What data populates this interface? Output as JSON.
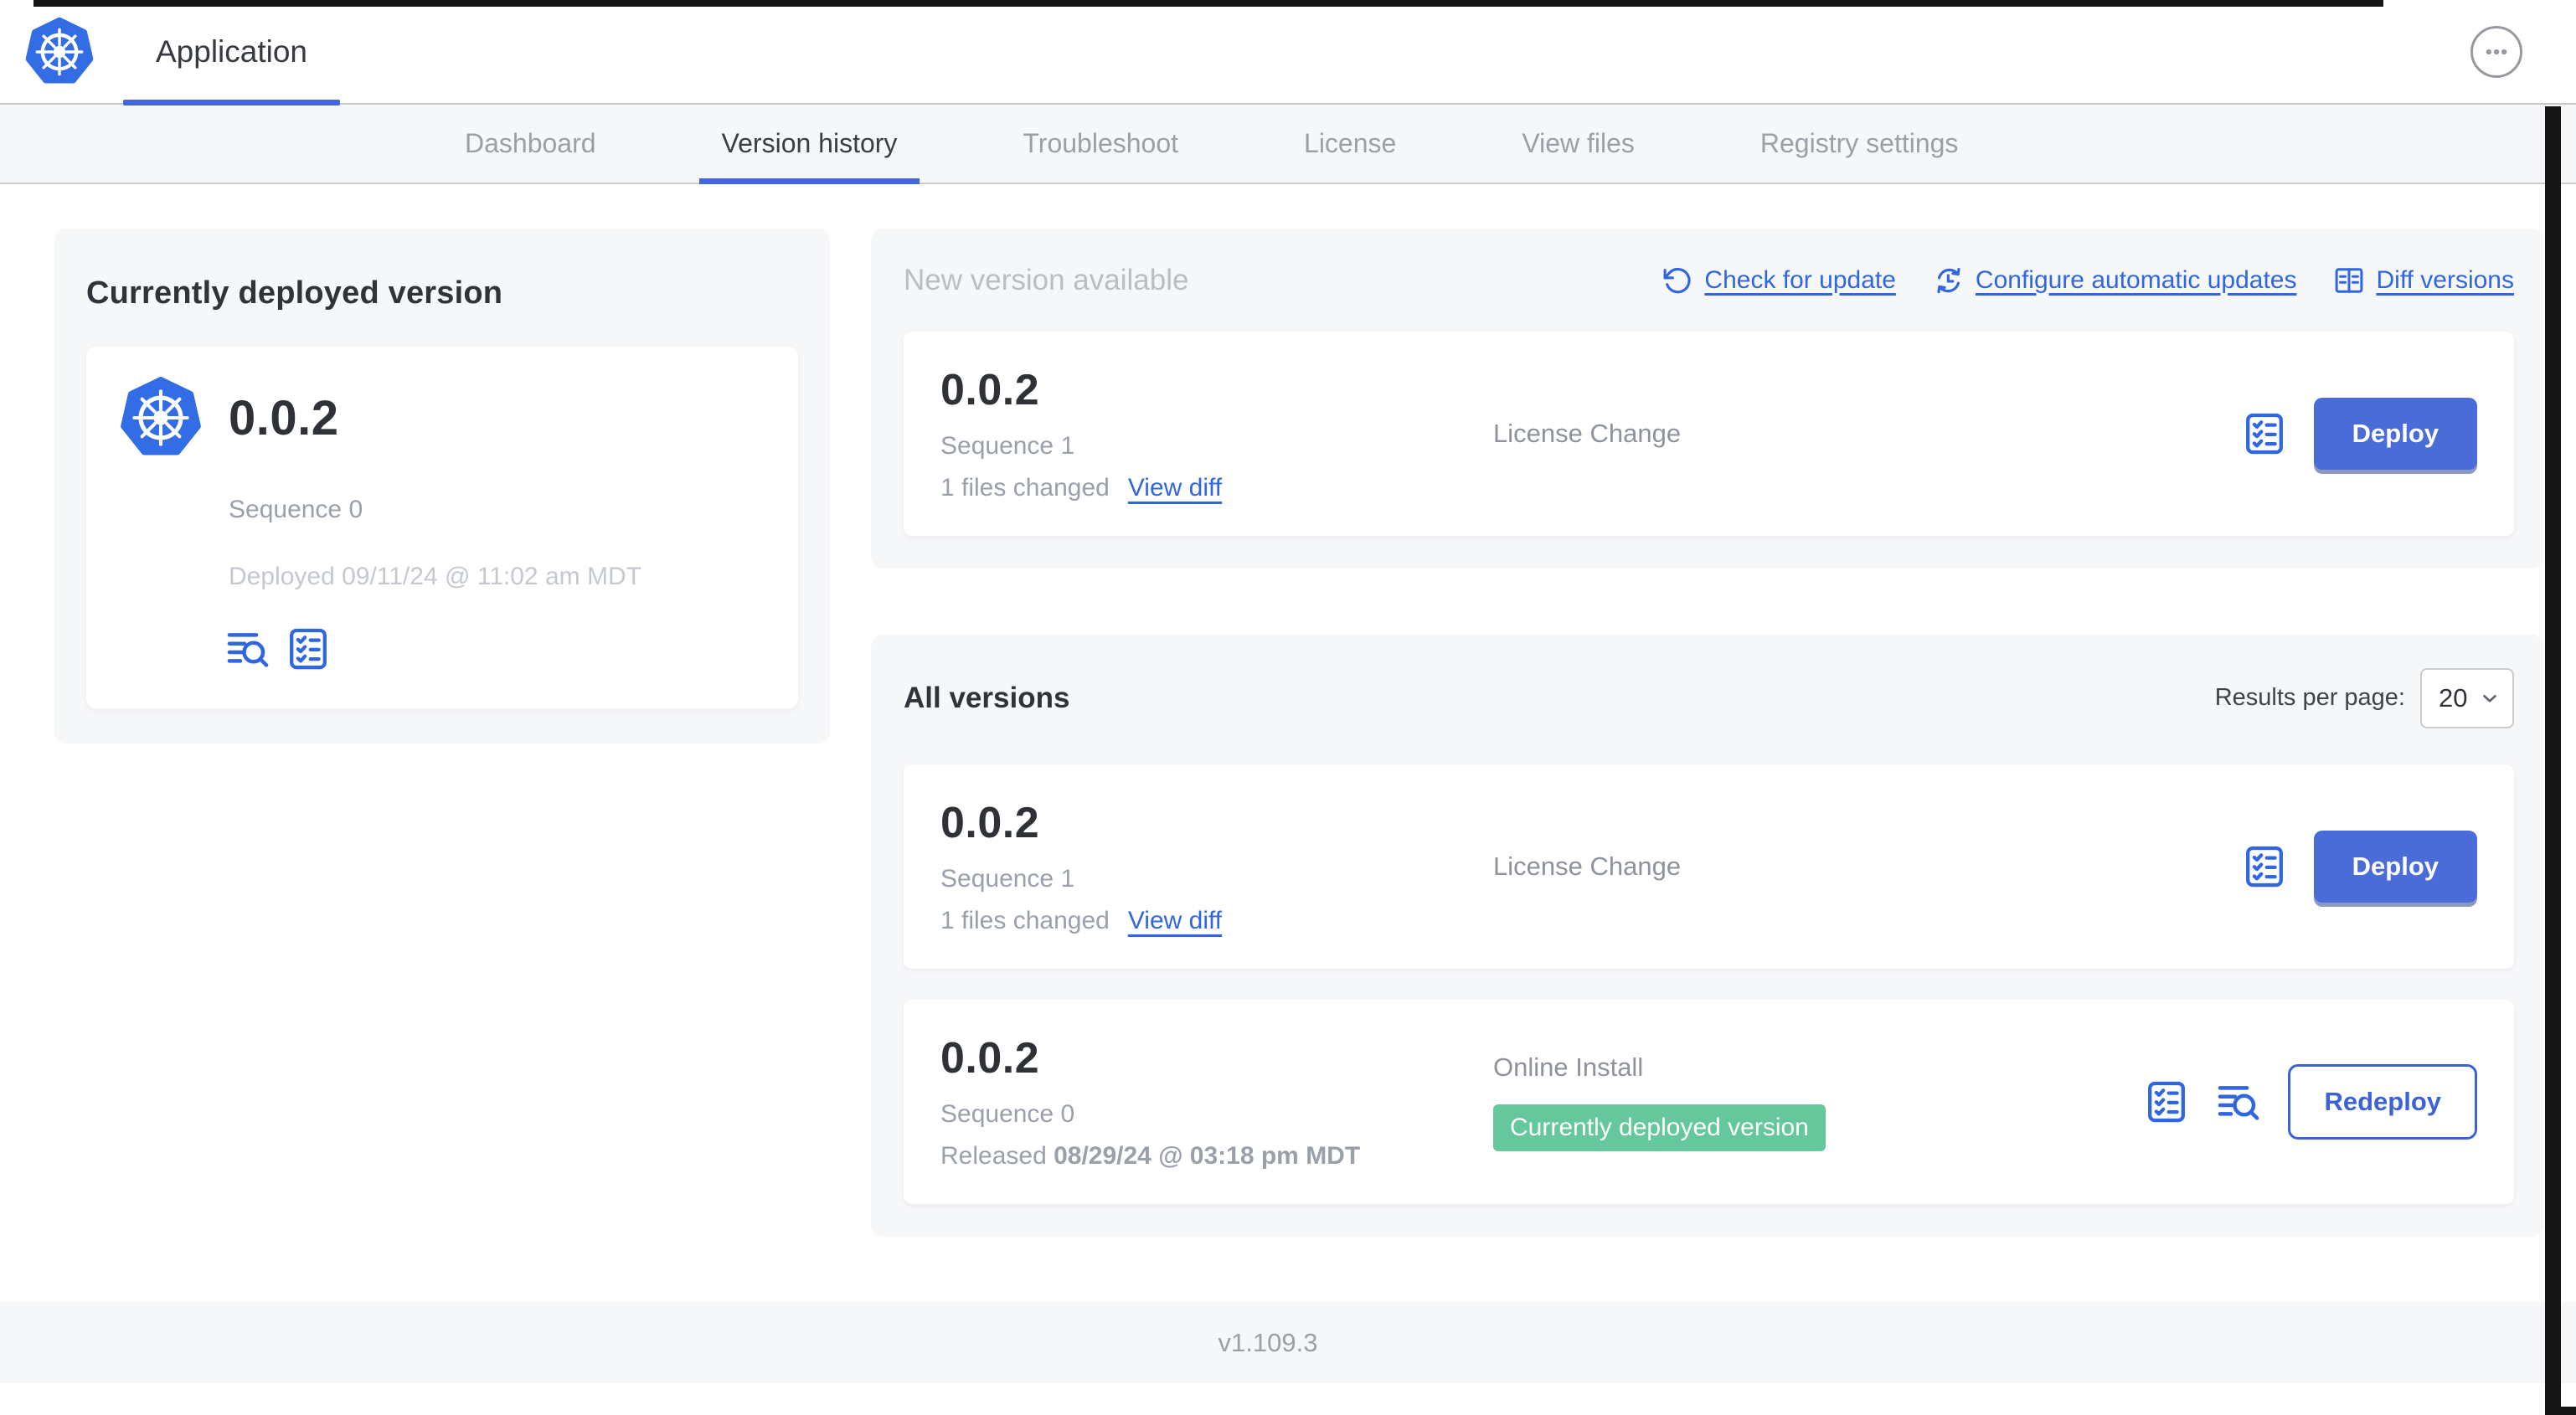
{
  "header": {
    "app_title": "Application"
  },
  "nav": {
    "active_tab": "Version history",
    "tabs": [
      {
        "label": "Dashboard"
      },
      {
        "label": "Version history"
      },
      {
        "label": "Troubleshoot"
      },
      {
        "label": "License"
      },
      {
        "label": "View files"
      },
      {
        "label": "Registry settings"
      }
    ]
  },
  "current_version_panel": {
    "title": "Currently deployed version",
    "version": "0.0.2",
    "sequence": "Sequence 0",
    "deployed_timestamp": "Deployed 09/11/24 @ 11:02 am MDT"
  },
  "new_version_panel": {
    "title": "New version available",
    "actions": {
      "check_for_update": "Check for update",
      "configure_automatic_updates": "Configure automatic updates",
      "diff_versions": "Diff versions"
    },
    "card": {
      "version": "0.0.2",
      "sequence": "Sequence 1",
      "files_changed": "1 files changed",
      "view_diff_label": "View diff",
      "source": "License Change",
      "action_label": "Deploy"
    }
  },
  "all_versions_panel": {
    "title": "All versions",
    "results_per_page_label": "Results per page:",
    "results_per_page_value": "20",
    "rows": [
      {
        "version": "0.0.2",
        "sequence": "Sequence 1",
        "files_changed": "1 files changed",
        "view_diff_label": "View diff",
        "source": "License Change",
        "action_label": "Deploy"
      },
      {
        "version": "0.0.2",
        "sequence": "Sequence 0",
        "released_prefix": "Released ",
        "released_timestamp": "08/29/24 @ 03:18 pm MDT",
        "source": "Online Install",
        "badge": "Currently deployed version",
        "action_label": "Redeploy"
      }
    ]
  },
  "footer": {
    "app_manager_version": "v1.109.3"
  },
  "colors": {
    "brand_blue": "#326de6",
    "link_blue": "#3066e0",
    "button_blue": "#4a6cd9",
    "badge_green": "#65c79c",
    "panel_gray": "#f6f7f9"
  }
}
